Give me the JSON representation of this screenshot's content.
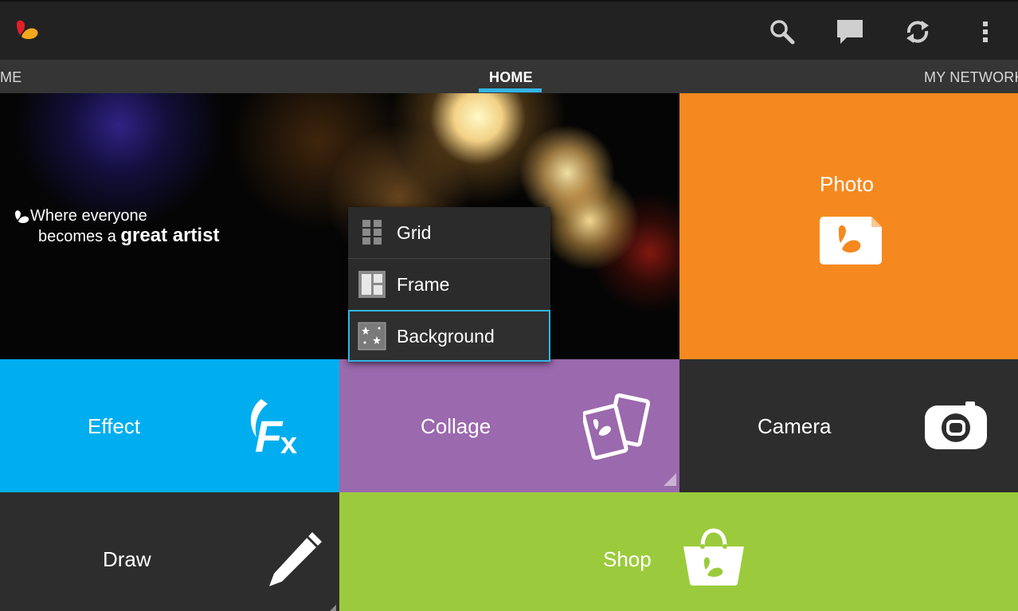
{
  "tabs": [
    {
      "label": "ME"
    },
    {
      "label": "HOME"
    },
    {
      "label": "MY NETWORK"
    }
  ],
  "actions": [
    "search-icon",
    "chat-icon",
    "sync-icon",
    "overflow-menu-icon"
  ],
  "hero": {
    "line1": "Where everyone",
    "line2_prefix": "becomes a ",
    "line2_bold": "great artist"
  },
  "tiles": {
    "photo": "Photo",
    "effect": "Effect",
    "collage": "Collage",
    "camera": "Camera",
    "draw": "Draw",
    "shop": "Shop"
  },
  "menu": {
    "items": [
      {
        "label": "Grid"
      },
      {
        "label": "Frame"
      },
      {
        "label": "Background"
      }
    ]
  },
  "colors": {
    "accent": "#33b5e5",
    "photo": "#f5891f",
    "effect": "#00aeef",
    "collage": "#9b69ad",
    "camera": "#2d2d2d",
    "draw": "#2d2d2d",
    "shop": "#9bcb3c"
  }
}
